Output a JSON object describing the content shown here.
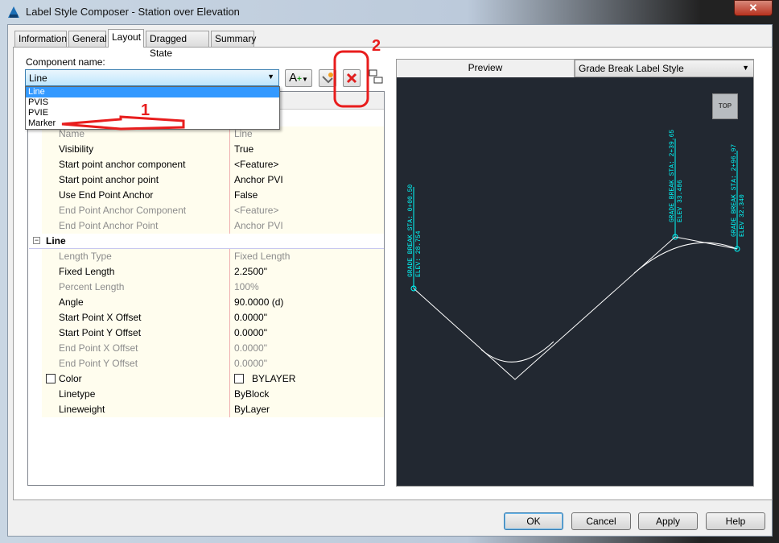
{
  "window": {
    "title": "Label Style Composer - Station over Elevation",
    "close": "✕"
  },
  "tabs": [
    "Information",
    "General",
    "Layout",
    "Dragged State",
    "Summary"
  ],
  "active_tab": "Layout",
  "component": {
    "label": "Component name:",
    "value": "Line",
    "options": [
      "Line",
      "PVIS",
      "PVIE",
      "Marker"
    ]
  },
  "toolbar": {
    "add_component": "A",
    "add_plus": "+",
    "copy_icon": "copy-component-icon",
    "delete_icon": "delete-component-icon",
    "order_icon": "component-draw-order-icon"
  },
  "properties": {
    "general_rows": [
      {
        "k": "Name",
        "v": "Line",
        "dis": true
      },
      {
        "k": "Visibility",
        "v": "True"
      },
      {
        "k": "Start point anchor component",
        "v": "<Feature>"
      },
      {
        "k": "Start point anchor point",
        "v": "Anchor PVI"
      },
      {
        "k": "Use End Point Anchor",
        "v": "False"
      },
      {
        "k": "End Point Anchor Component",
        "v": "<Feature>",
        "dis": true
      },
      {
        "k": "End Point Anchor Point",
        "v": "Anchor PVI",
        "dis": true
      }
    ],
    "line_category": "Line",
    "line_rows": [
      {
        "k": "Length Type",
        "v": "Fixed Length",
        "dis": true
      },
      {
        "k": "Fixed Length",
        "v": "2.2500\""
      },
      {
        "k": "Percent Length",
        "v": "100%",
        "dis": true
      },
      {
        "k": "Angle",
        "v": "90.0000 (d)"
      },
      {
        "k": "Start Point X Offset",
        "v": "0.0000\""
      },
      {
        "k": "Start Point Y Offset",
        "v": "0.0000\""
      },
      {
        "k": "End Point X Offset",
        "v": "0.0000\"",
        "dis": true
      },
      {
        "k": "End Point Y Offset",
        "v": "0.0000\"",
        "dis": true
      },
      {
        "k": "Color",
        "v": "BYLAYER",
        "swatch": true
      },
      {
        "k": "Linetype",
        "v": "ByBlock"
      },
      {
        "k": "Lineweight",
        "v": "ByLayer"
      }
    ]
  },
  "preview": {
    "header": "Preview",
    "style": "Grade Break Label Style",
    "view_cube": "TOP",
    "labels": [
      {
        "sta": "GRADE BREAK STA: 0+00.50",
        "elev": "ELEV: 28.754"
      },
      {
        "sta": "GRADE BREAK STA: 2+39.65",
        "elev": "ELEV 33.486"
      },
      {
        "sta": "GRADE BREAK STA: 2+96.97",
        "elev": "ELEV 32.340"
      }
    ],
    "line_color": "#00ffff"
  },
  "annotations": [
    "1",
    "2"
  ],
  "buttons": {
    "ok": "OK",
    "cancel": "Cancel",
    "apply": "Apply",
    "help": "Help"
  }
}
